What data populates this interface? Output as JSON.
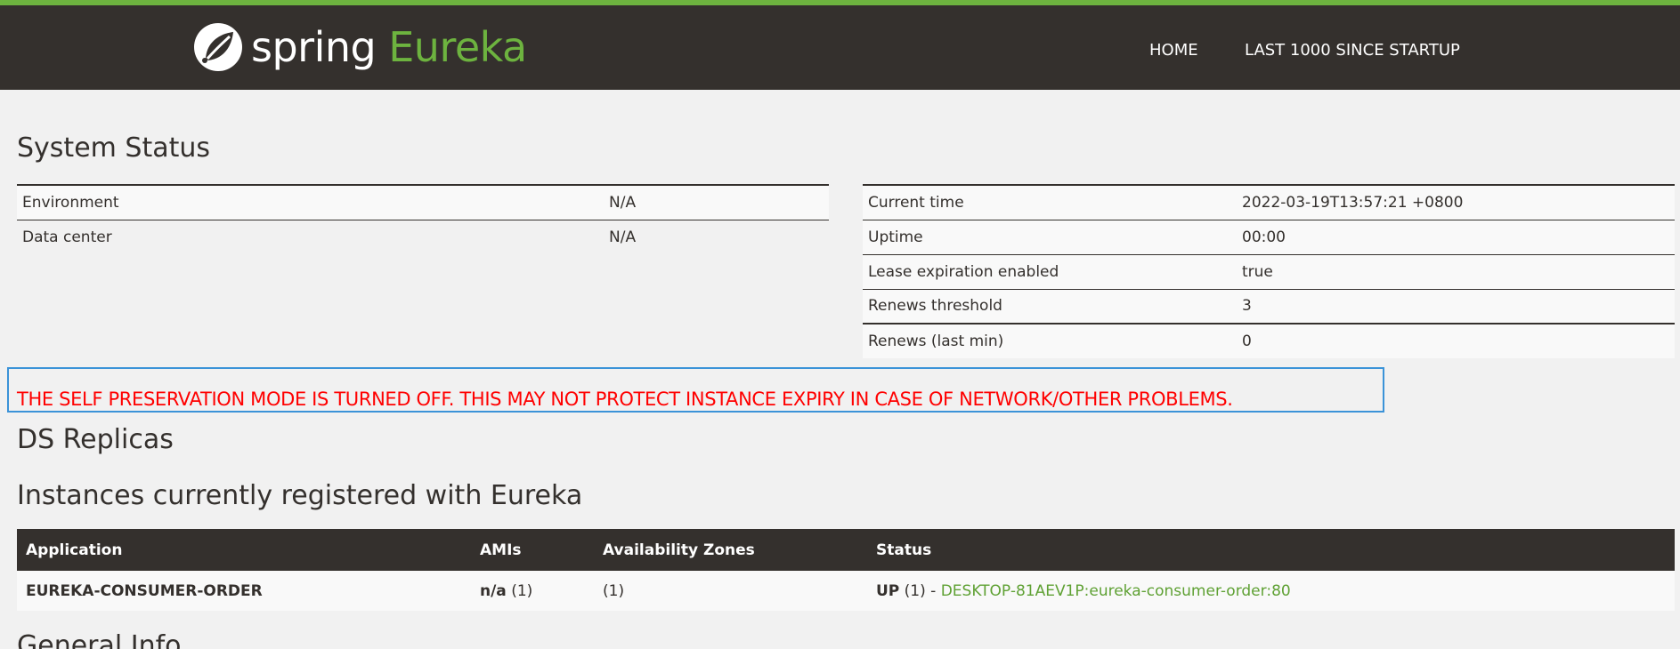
{
  "header": {
    "logo_spring": "spring",
    "logo_eureka": "Eureka",
    "nav": {
      "home": "HOME",
      "last1000": "LAST 1000 SINCE STARTUP"
    }
  },
  "system_status": {
    "title": "System Status",
    "left": [
      {
        "label": "Environment",
        "value": "N/A"
      },
      {
        "label": "Data center",
        "value": "N/A"
      }
    ],
    "right": [
      {
        "label": "Current time",
        "value": "2022-03-19T13:57:21 +0800"
      },
      {
        "label": "Uptime",
        "value": "00:00"
      },
      {
        "label": "Lease expiration enabled",
        "value": "true"
      },
      {
        "label": "Renews threshold",
        "value": "3"
      },
      {
        "label": "Renews (last min)",
        "value": "0"
      }
    ]
  },
  "warning": "THE SELF PRESERVATION MODE IS TURNED OFF. THIS MAY NOT PROTECT INSTANCE EXPIRY IN CASE OF NETWORK/OTHER PROBLEMS.",
  "replicas_title": "DS Replicas",
  "instances": {
    "title": "Instances currently registered with Eureka",
    "columns": [
      "Application",
      "AMIs",
      "Availability Zones",
      "Status"
    ],
    "rows": [
      {
        "application": "EUREKA-CONSUMER-ORDER",
        "ami_label": "n/a",
        "ami_count": "(1)",
        "zones": "(1)",
        "status_label": "UP",
        "status_count": "(1)",
        "separator": "-",
        "instance_link": "DESKTOP-81AEV1P:eureka-consumer-order:80"
      }
    ]
  },
  "general_info_title": "General Info",
  "colors": {
    "brand_green": "#6db33f",
    "header_bg": "#34302d",
    "warning_red": "#ff0000",
    "focus_blue": "#3b93d8"
  }
}
